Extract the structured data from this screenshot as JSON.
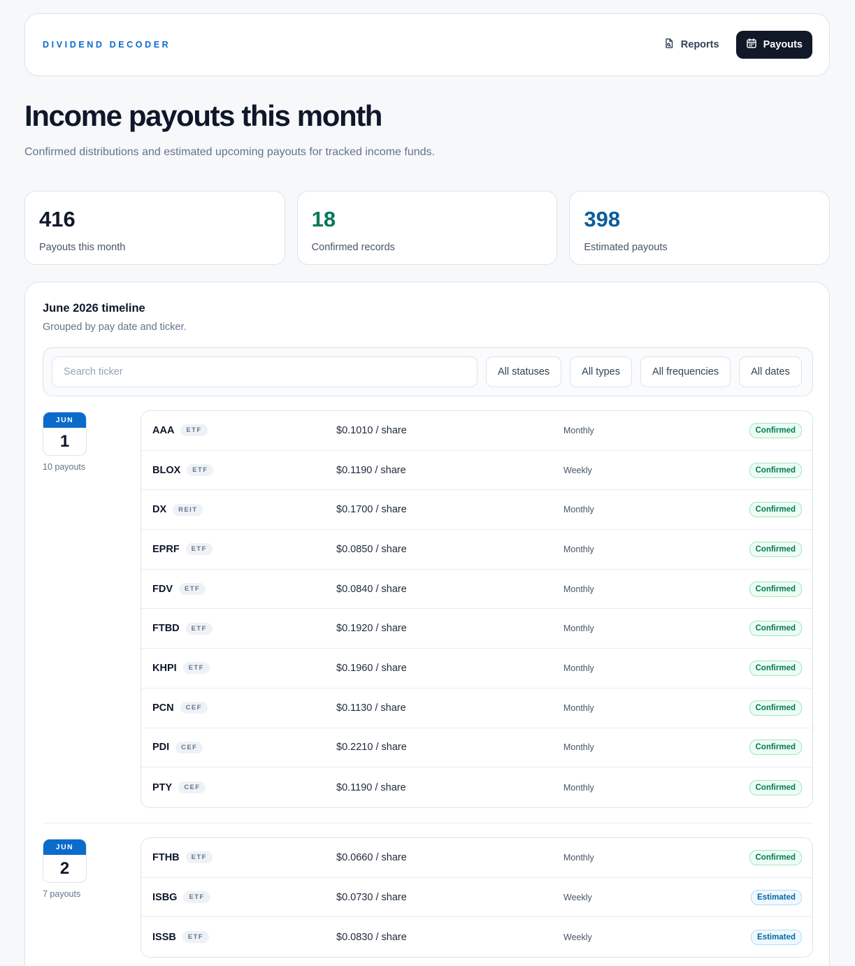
{
  "nav": {
    "brand": "DIVIDEND DECODER",
    "reports_label": "Reports",
    "payouts_label": "Payouts"
  },
  "page": {
    "title": "Income payouts this month",
    "subtitle": "Confirmed distributions and estimated upcoming payouts for tracked income funds."
  },
  "stats": [
    {
      "value": "416",
      "label": "Payouts this month",
      "color": "#0f172a"
    },
    {
      "value": "18",
      "label": "Confirmed records",
      "color": "#047857"
    },
    {
      "value": "398",
      "label": "Estimated payouts",
      "color": "#075e9c"
    }
  ],
  "timeline": {
    "title": "June 2026 timeline",
    "subtitle": "Grouped by pay date and ticker.",
    "search_placeholder": "Search ticker",
    "filters": [
      "All statuses",
      "All types",
      "All frequencies",
      "All dates"
    ]
  },
  "groups": [
    {
      "month": "JUN",
      "day": "1",
      "count_label": "10 payouts",
      "rows": [
        {
          "ticker": "AAA",
          "type": "ETF",
          "amount": "$0.1010 / share",
          "frequency": "Monthly",
          "status": "Confirmed"
        },
        {
          "ticker": "BLOX",
          "type": "ETF",
          "amount": "$0.1190 / share",
          "frequency": "Weekly",
          "status": "Confirmed"
        },
        {
          "ticker": "DX",
          "type": "REIT",
          "amount": "$0.1700 / share",
          "frequency": "Monthly",
          "status": "Confirmed"
        },
        {
          "ticker": "EPRF",
          "type": "ETF",
          "amount": "$0.0850 / share",
          "frequency": "Monthly",
          "status": "Confirmed"
        },
        {
          "ticker": "FDV",
          "type": "ETF",
          "amount": "$0.0840 / share",
          "frequency": "Monthly",
          "status": "Confirmed"
        },
        {
          "ticker": "FTBD",
          "type": "ETF",
          "amount": "$0.1920 / share",
          "frequency": "Monthly",
          "status": "Confirmed"
        },
        {
          "ticker": "KHPI",
          "type": "ETF",
          "amount": "$0.1960 / share",
          "frequency": "Monthly",
          "status": "Confirmed"
        },
        {
          "ticker": "PCN",
          "type": "CEF",
          "amount": "$0.1130 / share",
          "frequency": "Monthly",
          "status": "Confirmed"
        },
        {
          "ticker": "PDI",
          "type": "CEF",
          "amount": "$0.2210 / share",
          "frequency": "Monthly",
          "status": "Confirmed"
        },
        {
          "ticker": "PTY",
          "type": "CEF",
          "amount": "$0.1190 / share",
          "frequency": "Monthly",
          "status": "Confirmed"
        }
      ]
    },
    {
      "month": "JUN",
      "day": "2",
      "count_label": "7 payouts",
      "rows": [
        {
          "ticker": "FTHB",
          "type": "ETF",
          "amount": "$0.0660 / share",
          "frequency": "Monthly",
          "status": "Confirmed"
        },
        {
          "ticker": "ISBG",
          "type": "ETF",
          "amount": "$0.0730 / share",
          "frequency": "Weekly",
          "status": "Estimated"
        },
        {
          "ticker": "ISSB",
          "type": "ETF",
          "amount": "$0.0830 / share",
          "frequency": "Weekly",
          "status": "Estimated"
        }
      ]
    }
  ]
}
